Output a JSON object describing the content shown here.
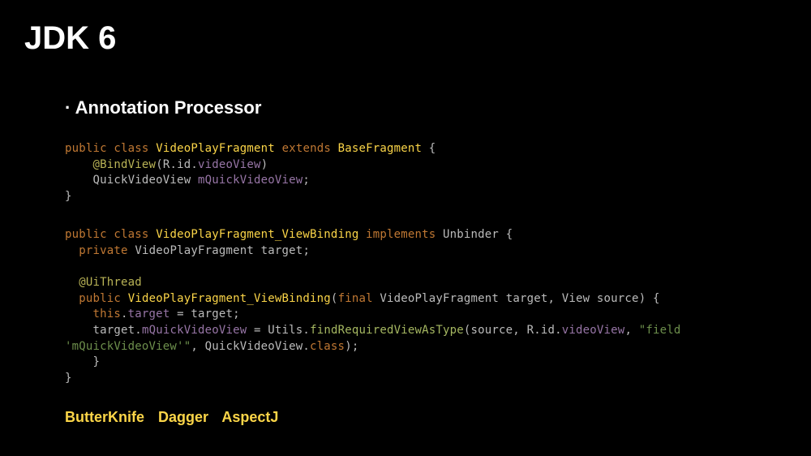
{
  "title": "JDK 6",
  "subtitle": "· Annotation Processor",
  "code1": {
    "l1_public": "public",
    "l1_class": "class",
    "l1_name": "VideoPlayFragment",
    "l1_extends": "extends",
    "l1_base": "BaseFragment",
    "l1_brace": " {",
    "l2_indent": "    ",
    "l2_anno": "@BindView",
    "l2_open": "(",
    "l2_r": "R",
    "l2_dot1": ".",
    "l2_id": "id",
    "l2_dot2": ".",
    "l2_vv": "videoView",
    "l2_close": ")",
    "l3_indent": "    ",
    "l3_type": "QuickVideoView",
    "l3_space": " ",
    "l3_field": "mQuickVideoView",
    "l3_semi": ";",
    "l4_brace": "}"
  },
  "code2": {
    "l1_public": "public",
    "l1_class": "class",
    "l1_name": "VideoPlayFragment_ViewBinding",
    "l1_impl": "implements",
    "l1_unb": "Unbinder",
    "l1_brace": " {",
    "l2_indent": "  ",
    "l2_priv": "private",
    "l2_type": "VideoPlayFragment",
    "l2_field": "target",
    "l2_semi": ";",
    "l3_blank": "",
    "l4_indent": "  ",
    "l4_anno": "@UiThread",
    "l5_indent": "  ",
    "l5_public": "public",
    "l5_ctor": "VideoPlayFragment_ViewBinding",
    "l5_open": "(",
    "l5_final": "final",
    "l5_ptype": "VideoPlayFragment",
    "l5_pname": "target",
    "l5_comma": ", ",
    "l5_view": "View",
    "l5_src": "source",
    "l5_close": ") {",
    "l6_indent": "    ",
    "l6_this": "this",
    "l6_dot": ".",
    "l6_tgt": "target",
    "l6_eq": " = target;",
    "l7_indent": "    ",
    "l7_tgt": "target",
    "l7_dot": ".",
    "l7_field": "mQuickVideoView",
    "l7_eq": " = ",
    "l7_utils": "Utils",
    "l7_dot2": ".",
    "l7_method": "findRequiredViewAsType",
    "l7_open": "(source, ",
    "l7_r": "R",
    "l7_dot3": ".",
    "l7_id": "id",
    "l7_dot4": ".",
    "l7_vv": "videoView",
    "l7_comma": ", ",
    "l7_str": "\"field ",
    "l8_str": "'mQuickVideoView'\"",
    "l8_comma": ", ",
    "l8_qvv": "QuickVideoView",
    "l8_dot": ".",
    "l8_class": "class",
    "l8_close": ");",
    "l9_indent": "    ",
    "l9_brace": "}",
    "l10_brace": "}"
  },
  "libs": {
    "a": "ButterKnife",
    "b": "Dagger",
    "c": "AspectJ"
  }
}
